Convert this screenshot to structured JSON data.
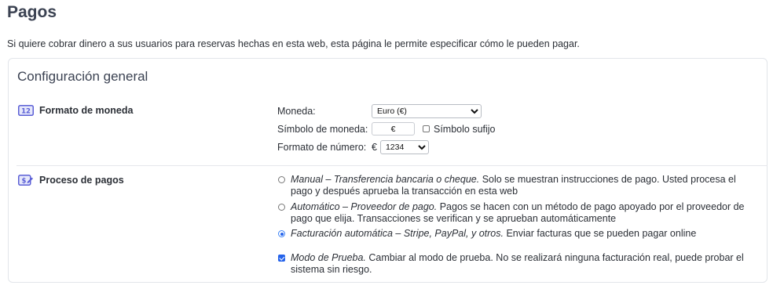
{
  "page": {
    "title": "Pagos",
    "intro": "Si quiere cobrar dinero a sus usuarios para reservas hechas en esta web, esta página le permite especificar cómo le pueden pagar."
  },
  "card": {
    "title": "Configuración general"
  },
  "currency_section": {
    "label": "Formato de moneda",
    "icon": "currency-format-icon",
    "moneda_label": "Moneda:",
    "moneda_value": "Euro (€)",
    "simbolo_label": "Símbolo de moneda:",
    "simbolo_value": "€",
    "sufijo_label": "Símbolo sufijo",
    "sufijo_checked": false,
    "formato_label": "Formato de número:",
    "formato_prefix": "€",
    "formato_value": "1234"
  },
  "payment_section": {
    "label": "Proceso de pagos",
    "icon": "payment-process-icon",
    "options": [
      {
        "title": "Manual – Transferencia bancaria o cheque.",
        "description": "Solo se muestran instrucciones de pago. Usted procesa el pago y después aprueba la transacción en esta web",
        "selected": false
      },
      {
        "title": "Automático – Proveedor de pago.",
        "description": "Pagos se hacen con un método de pago apoyado por el proveedor de pago que elija. Transacciones se verifican y se aprueban automáticamente",
        "selected": false
      },
      {
        "title": "Facturación automática – Stripe, PayPal, y otros.",
        "description": "Enviar facturas que se pueden pagar online",
        "selected": true
      }
    ],
    "test_mode": {
      "title": "Modo de Prueba.",
      "description": "Cambiar al modo de prueba. No se realizará ninguna facturación real, puede probar el sistema sin riesgo.",
      "checked": true
    }
  },
  "colors": {
    "accent": "#2563eb",
    "icon": "#5b5fd6",
    "text": "#2b2f36",
    "heading": "#3b4252"
  }
}
